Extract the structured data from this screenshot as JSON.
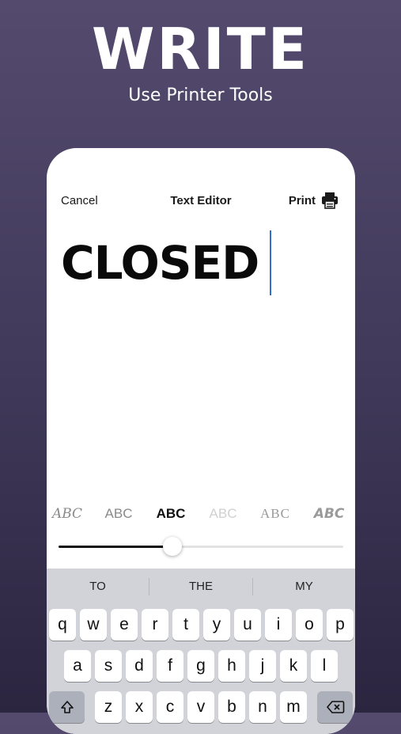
{
  "promo": {
    "headline": "WRITE",
    "subhead": "Use Printer Tools"
  },
  "nav": {
    "cancel_label": "Cancel",
    "title": "Text Editor",
    "print_label": "Print"
  },
  "editor": {
    "text": "CLOSED",
    "cursor_color": "#2f6fd6"
  },
  "font_options": [
    "ABC",
    "ABC",
    "ABC",
    "ABC",
    "ABC",
    "ABC"
  ],
  "selected_font_index": 2,
  "slider": {
    "value_fraction": 0.4
  },
  "keyboard": {
    "suggestions": [
      "TO",
      "THE",
      "MY"
    ],
    "row1": [
      "q",
      "w",
      "e",
      "r",
      "t",
      "y",
      "u",
      "i",
      "o",
      "p"
    ],
    "row2": [
      "a",
      "s",
      "d",
      "f",
      "g",
      "h",
      "j",
      "k",
      "l"
    ],
    "row3": [
      "z",
      "x",
      "c",
      "v",
      "b",
      "n",
      "m"
    ],
    "icons": {
      "shift": "shift-icon",
      "delete": "delete-icon",
      "print": "printer-icon"
    }
  }
}
